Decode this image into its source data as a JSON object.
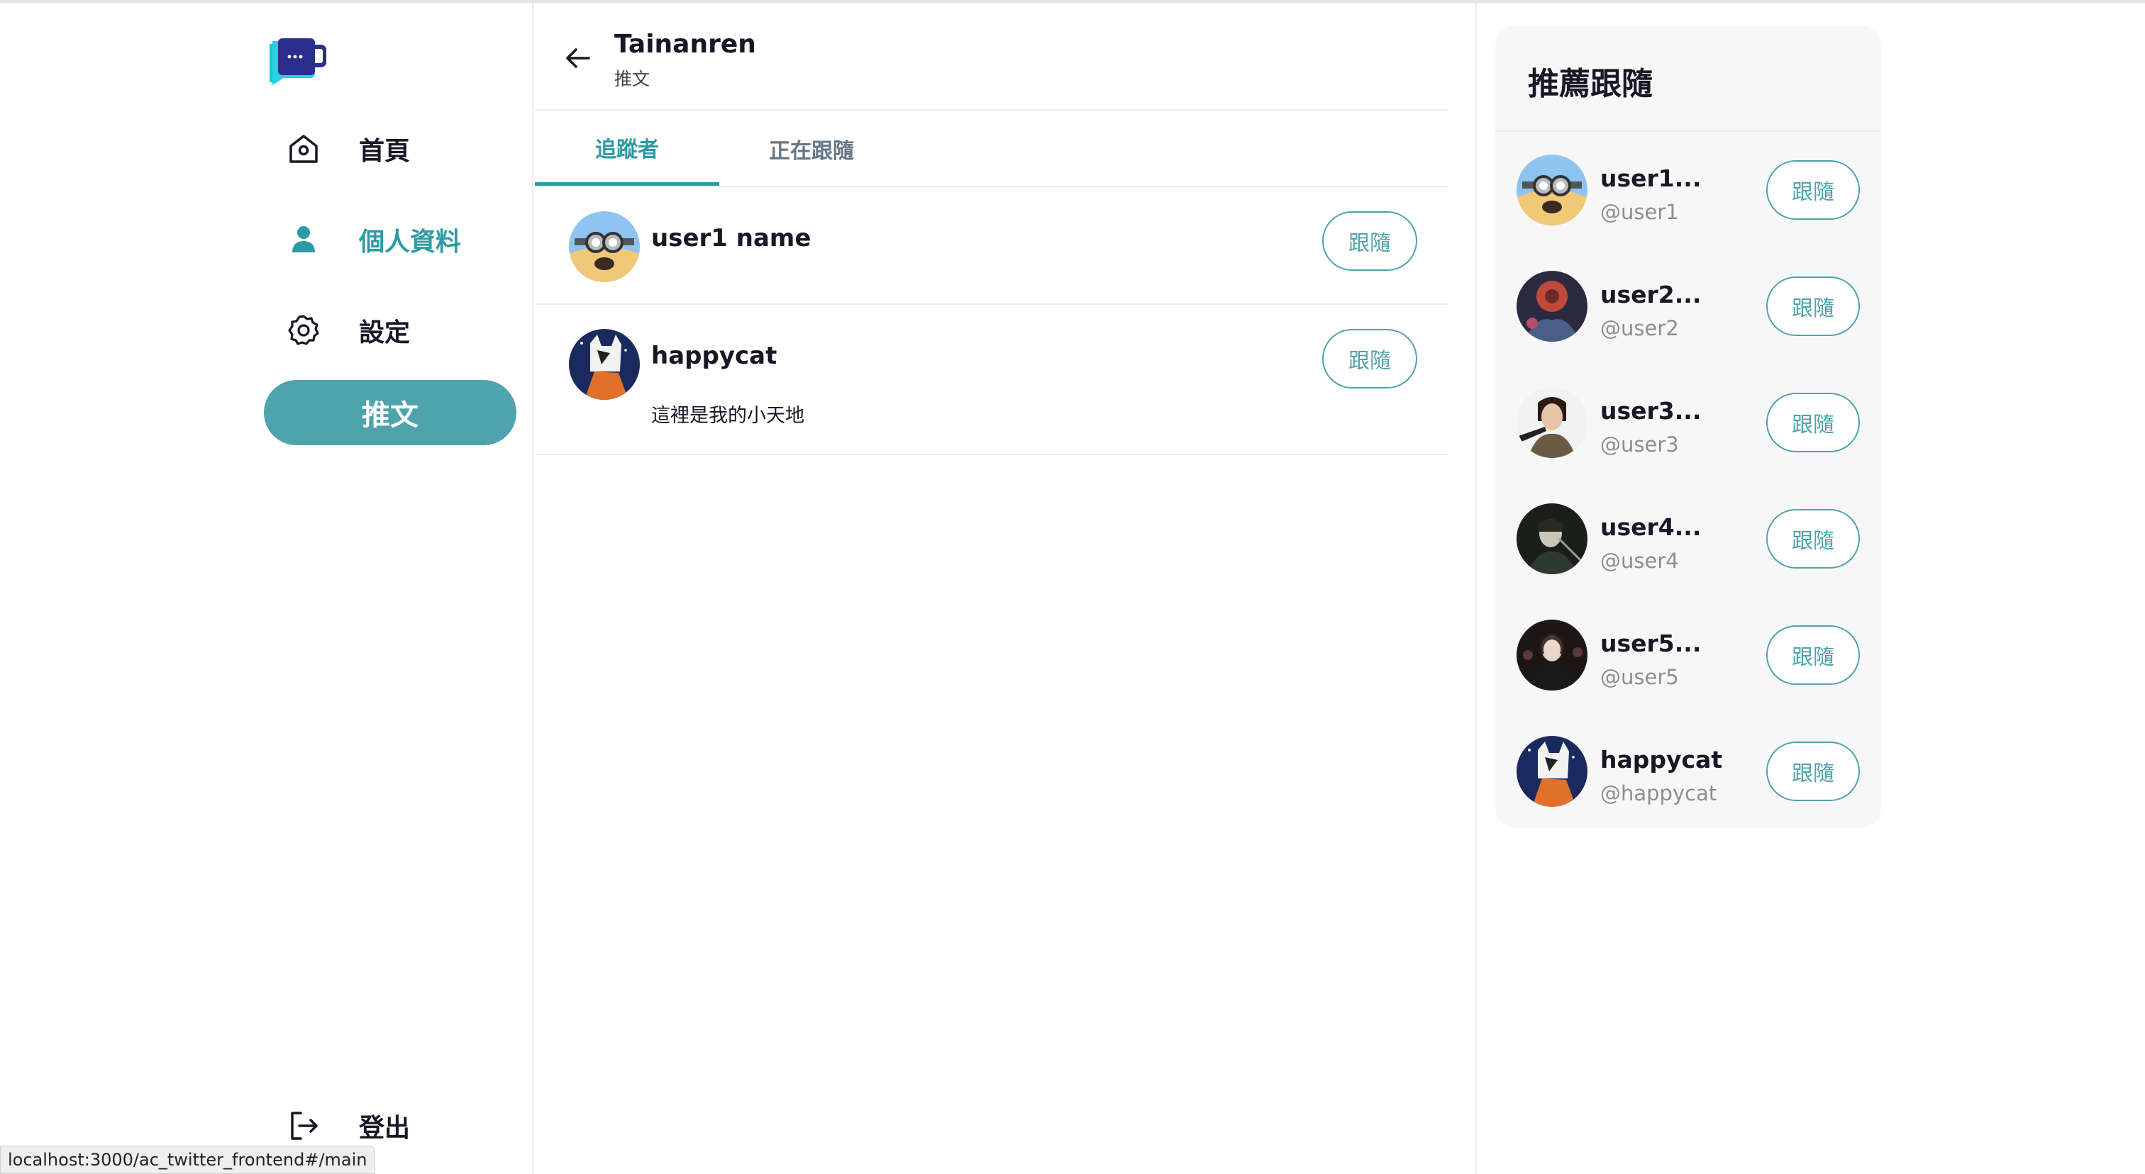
{
  "sidebar": {
    "items": [
      {
        "label": "首頁",
        "icon": "home-icon"
      },
      {
        "label": "個人資料",
        "icon": "user-icon",
        "active": true
      },
      {
        "label": "設定",
        "icon": "gear-icon"
      }
    ],
    "tweet_button": "推文",
    "logout": "登出"
  },
  "header": {
    "name": "Tainanren",
    "subtitle": "推文"
  },
  "tabs": [
    {
      "label": "追蹤者",
      "active": true
    },
    {
      "label": "正在跟隨",
      "active": false
    }
  ],
  "followers": [
    {
      "name": "user1 name",
      "bio": "",
      "button": "跟隨"
    },
    {
      "name": "happycat",
      "bio": "這裡是我的小天地",
      "button": "跟隨"
    }
  ],
  "recommend": {
    "title": "推薦跟隨",
    "users": [
      {
        "name": "user1...",
        "handle": "@user1",
        "button": "跟隨"
      },
      {
        "name": "user2...",
        "handle": "@user2",
        "button": "跟隨"
      },
      {
        "name": "user3...",
        "handle": "@user3",
        "button": "跟隨"
      },
      {
        "name": "user4...",
        "handle": "@user4",
        "button": "跟隨"
      },
      {
        "name": "user5...",
        "handle": "@user5",
        "button": "跟隨"
      },
      {
        "name": "happycat",
        "handle": "@happycat",
        "button": "跟隨"
      }
    ]
  },
  "status_url": "localhost:3000/ac_twitter_frontend#/main",
  "colors": {
    "accent": "#2b9ba5",
    "button": "#4fa3ad"
  }
}
